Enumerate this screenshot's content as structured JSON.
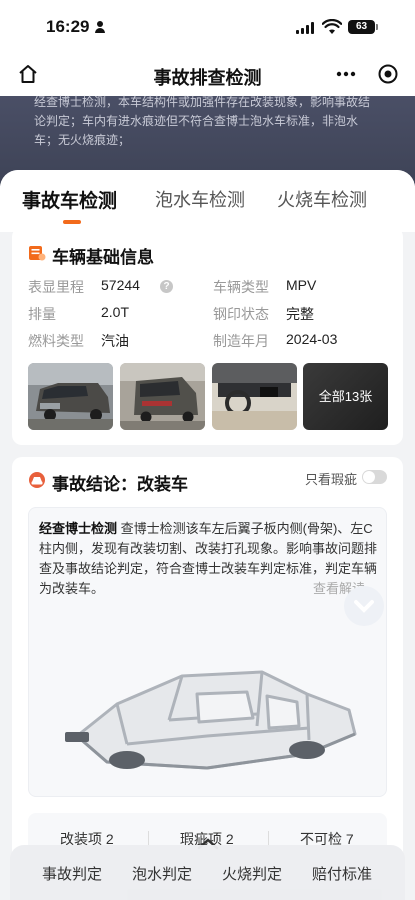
{
  "status_bar": {
    "time": "16:29",
    "battery": "63"
  },
  "nav": {
    "title": "事故排查检测"
  },
  "banner": {
    "text": "经查博士检测，本车结构件或加强件存在改装现象，影响事故结论判定；车内有进水痕迹但不符合查博士泡水车标准，非泡水车；无火烧痕迹；"
  },
  "tabs": [
    {
      "label": "事故车检测"
    },
    {
      "label": "泡水车检测"
    },
    {
      "label": "火烧车检测"
    }
  ],
  "vehicle": {
    "title": "车辆基础信息",
    "fields": [
      {
        "label": "表显里程",
        "value": "57244"
      },
      {
        "label": "车辆类型",
        "value": "MPV"
      },
      {
        "label": "排量",
        "value": "2.0T"
      },
      {
        "label": "钢印状态",
        "value": "完整"
      },
      {
        "label": "燃料类型",
        "value": "汽油"
      },
      {
        "label": "制造年月",
        "value": "2024-03"
      }
    ],
    "all_photos": "全部13张"
  },
  "conclusion": {
    "title": "事故结论：改装车",
    "toggle_label": "只看瑕疵",
    "source": "经查博士检测",
    "text": "查博士检测该车左后翼子板内侧(骨架)、左C柱内侧，发现有改装切割、改装打孔现象。影响事故问题排查及事故结论判定，符合查博士改装车判定标准，判定车辆为改装车。",
    "link": "查看解读"
  },
  "stats": [
    {
      "label": "改装项 2"
    },
    {
      "label": "瑕疵项 2"
    },
    {
      "label": "不可检 7"
    }
  ],
  "bottom_nav": [
    {
      "label": "事故判定"
    },
    {
      "label": "泡水判定"
    },
    {
      "label": "火烧判定"
    },
    {
      "label": "赔付标准"
    }
  ],
  "colors": {
    "accent": "#f26a1b",
    "banner": "#4a4f66"
  }
}
